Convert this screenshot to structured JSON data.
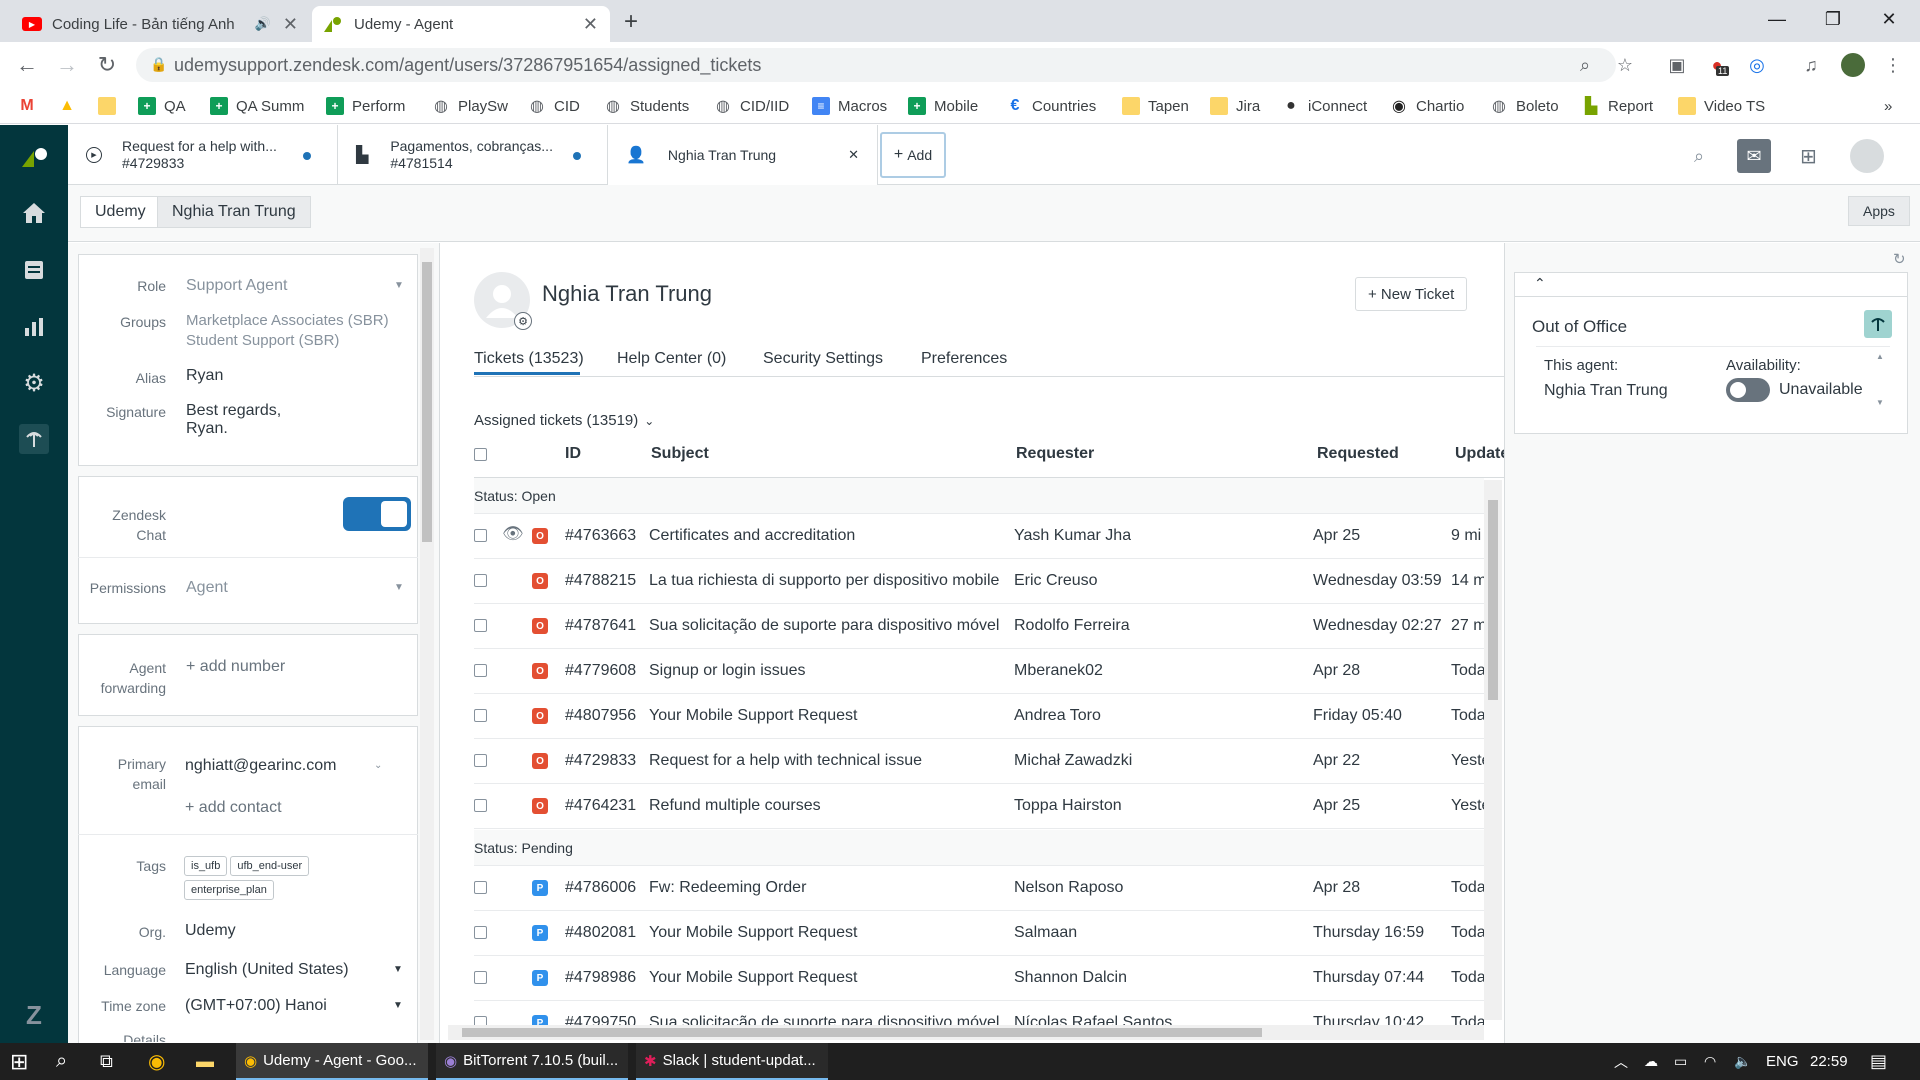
{
  "browser": {
    "tabs": [
      {
        "title": "Coding Life - Bản tiếng Anh",
        "icon": "youtube-icon"
      },
      {
        "title": "Udemy - Agent",
        "icon": "zendesk-icon"
      }
    ],
    "new_tab": "+",
    "url": "udemysupport.zendesk.com/agent/users/372867951654/assigned_tickets",
    "ext_badge": "11",
    "bookmarks": [
      "QA",
      "QA Summ",
      "Perform",
      "PlaySw",
      "CID",
      "Students",
      "CID/IID",
      "Macros",
      "Mobile",
      "Countries",
      "Tapen",
      "Jira",
      "iConnect",
      "Chartio",
      "Boleto",
      "Report",
      "Video TS"
    ],
    "more": "»"
  },
  "zendesk": {
    "tabs": [
      {
        "title": "Request for a help with...",
        "id": "#4729833"
      },
      {
        "title": "Pagamentos, cobranças...",
        "id": "#4781514"
      },
      {
        "title": "Nghia Tran Trung"
      }
    ],
    "add_label": "Add",
    "apps_label": "Apps",
    "breadcrumbs": [
      "Udemy",
      "Nghia Tran Trung"
    ],
    "user": {
      "role_label": "Role",
      "role": "Support Agent",
      "groups_label": "Groups",
      "groups": [
        "Marketplace Associates (SBR)",
        "Student Support (SBR)"
      ],
      "alias_label": "Alias",
      "alias": "Ryan",
      "signature_label": "Signature",
      "signature": [
        "Best regards,",
        "Ryan."
      ],
      "chat_label": [
        "Zendesk",
        "Chat"
      ],
      "permissions_label": "Permissions",
      "permissions": "Agent",
      "forwarding_label": [
        "Agent",
        "forwarding"
      ],
      "add_number": "+ add number",
      "email_label": [
        "Primary",
        "email"
      ],
      "email": "nghiatt@gearinc.com",
      "add_contact": "+ add contact",
      "tags_label": "Tags",
      "tags": [
        "is_ufb",
        "ufb_end-user",
        "enterprise_plan"
      ],
      "org_label": "Org.",
      "org": "Udemy",
      "language_label": "Language",
      "language": "English (United States)",
      "timezone_label": "Time zone",
      "timezone": "(GMT+07:00) Hanoi",
      "details_label": "Details"
    },
    "profile": {
      "name": "Nghia Tran Trung",
      "new_ticket": "+ New Ticket",
      "tabs": [
        "Tickets (13523)",
        "Help Center (0)",
        "Security Settings",
        "Preferences"
      ]
    },
    "tickets": {
      "view_title": "Assigned tickets (13519)",
      "columns": [
        "ID",
        "Subject",
        "Requester",
        "Requested",
        "Update"
      ],
      "open_label": "Status:",
      "open_value": "Open",
      "pending_label": "Status:",
      "pending_value": "Pending",
      "open_rows": [
        {
          "id": "#4763663",
          "subject": "Certificates and accreditation",
          "requester": "Yash Kumar Jha",
          "requested": "Apr 25",
          "updated": "9 mi"
        },
        {
          "id": "#4788215",
          "subject": "La tua richiesta di supporto per dispositivo mobile",
          "requester": "Eric Creuso",
          "requested": "Wednesday 03:59",
          "updated": "14 m"
        },
        {
          "id": "#4787641",
          "subject": "Sua solicitação de suporte para dispositivo móvel",
          "requester": "Rodolfo Ferreira",
          "requested": "Wednesday 02:27",
          "updated": "27 m"
        },
        {
          "id": "#4779608",
          "subject": "Signup or login issues",
          "requester": "Mberanek02",
          "requested": "Apr 28",
          "updated": "Toda"
        },
        {
          "id": "#4807956",
          "subject": "Your Mobile Support Request",
          "requester": "Andrea Toro",
          "requested": "Friday 05:40",
          "updated": "Toda"
        },
        {
          "id": "#4729833",
          "subject": "Request for a help with technical issue",
          "requester": "Michał Zawadzki",
          "requested": "Apr 22",
          "updated": "Yeste"
        },
        {
          "id": "#4764231",
          "subject": "Refund multiple courses",
          "requester": "Toppa Hairston",
          "requested": "Apr 25",
          "updated": "Yeste"
        }
      ],
      "pending_rows": [
        {
          "id": "#4786006",
          "subject": "Fw: Redeeming Order",
          "requester": "Nelson Raposo",
          "requested": "Apr 28",
          "updated": "Toda"
        },
        {
          "id": "#4802081",
          "subject": "Your Mobile Support Request",
          "requester": "Salmaan",
          "requested": "Thursday 16:59",
          "updated": "Toda"
        },
        {
          "id": "#4798986",
          "subject": "Your Mobile Support Request",
          "requester": "Shannon Dalcin",
          "requested": "Thursday 07:44",
          "updated": "Toda"
        },
        {
          "id": "#4799750",
          "subject": "Sua solicitação de suporte para dispositivo móvel",
          "requester": "Nícolas Rafael Santos",
          "requested": "Thursday 10:42",
          "updated": "Toda"
        }
      ],
      "open_badge": "O",
      "pending_badge": "P"
    },
    "app": {
      "title": "Out of Office",
      "agent_label": "This agent:",
      "agent": "Nghia Tran Trung",
      "availability_label": "Availability:",
      "availability": "Unavailable"
    }
  },
  "taskbar": {
    "apps": [
      "Udemy - Agent - Goo...",
      "BitTorrent 7.10.5  (buil...",
      "Slack | student-updat..."
    ],
    "lang": "ENG",
    "time": "22:59"
  },
  "colors": {
    "sidebar": "#03363d",
    "open": "#e34f32",
    "pending": "#3091ec",
    "accent": "#1f73b7"
  }
}
